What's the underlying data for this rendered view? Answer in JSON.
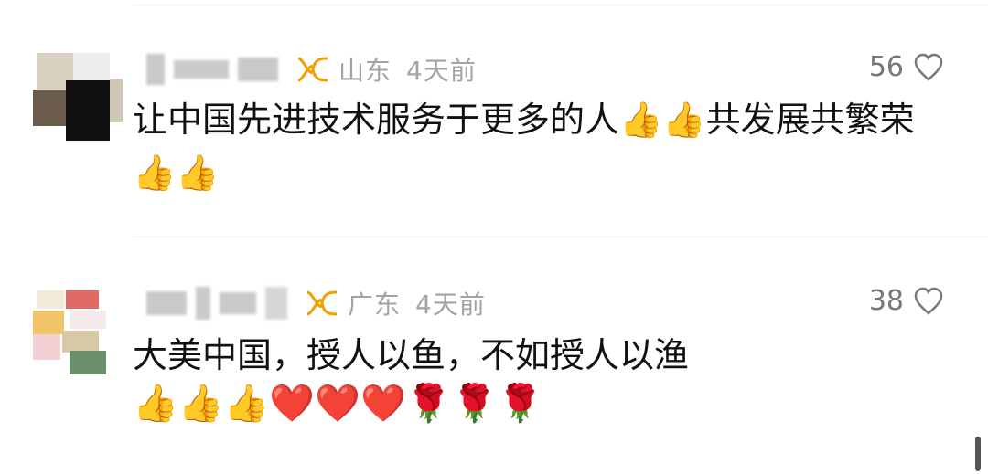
{
  "comments": [
    {
      "location": "山东",
      "time": "4天前",
      "likes": "56",
      "text": "让中国先进技术服务于更多的人👍👍共发展共繁荣👍👍"
    },
    {
      "location": "广东",
      "time": "4天前",
      "likes": "38",
      "text": "大美中国，授人以鱼，不如授人以渔",
      "emojis": "👍👍👍❤️❤️❤️🌹🌹🌹"
    }
  ],
  "colors": {
    "ip_icon": "#f0a000",
    "meta_text": "#a3a3a3"
  }
}
